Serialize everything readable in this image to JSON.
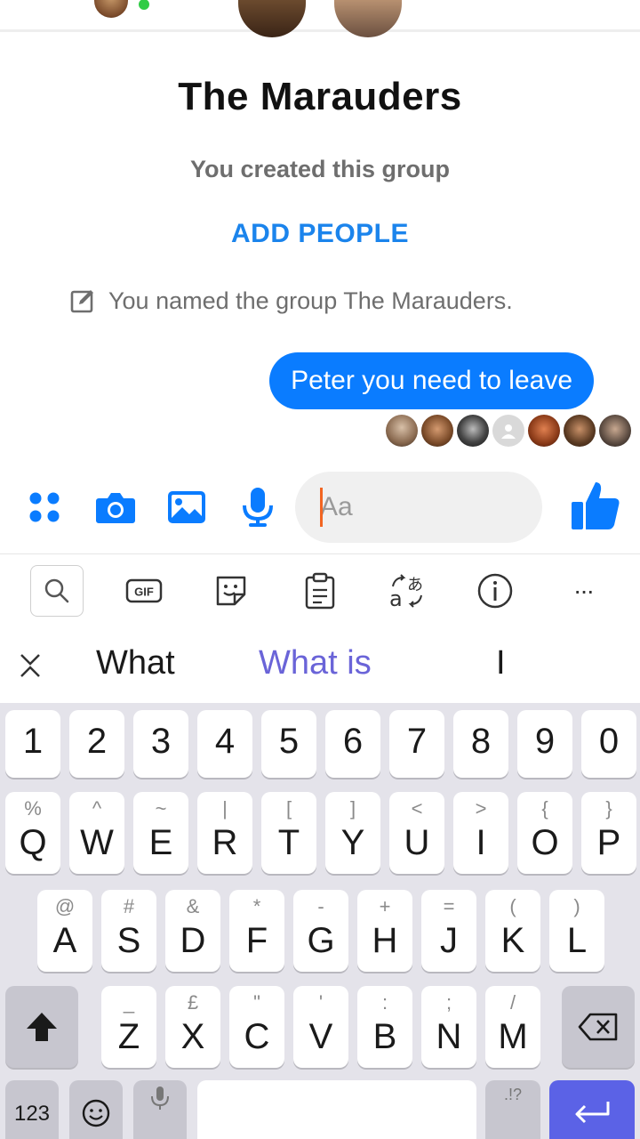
{
  "chat": {
    "title": "The Marauders",
    "created_text": "You created this group",
    "add_people_label": "ADD PEOPLE",
    "named_text": "You named the group The Marauders.",
    "messages": [
      {
        "text": "Peter you need to leave",
        "from": "me"
      }
    ],
    "seen_count": 7
  },
  "composer": {
    "input_placeholder": "Aa",
    "icons": [
      "apps-icon",
      "camera-icon",
      "image-icon",
      "mic-icon",
      "emoji-icon",
      "thumbs-up-icon"
    ]
  },
  "keyboard": {
    "toolbar_icons": [
      "search-icon",
      "gif-icon",
      "sticker-icon",
      "clipboard-icon",
      "translate-icon",
      "info-icon",
      "more-icon"
    ],
    "gif_label": "GIF",
    "more_label": "···",
    "suggestions": [
      "What",
      "What is",
      "I"
    ],
    "number_row": [
      "1",
      "2",
      "3",
      "4",
      "5",
      "6",
      "7",
      "8",
      "9",
      "0"
    ],
    "row1": [
      {
        "main": "Q",
        "alt": "%"
      },
      {
        "main": "W",
        "alt": "^"
      },
      {
        "main": "E",
        "alt": "~"
      },
      {
        "main": "R",
        "alt": "|"
      },
      {
        "main": "T",
        "alt": "["
      },
      {
        "main": "Y",
        "alt": "]"
      },
      {
        "main": "U",
        "alt": "<"
      },
      {
        "main": "I",
        "alt": ">"
      },
      {
        "main": "O",
        "alt": "{"
      },
      {
        "main": "P",
        "alt": "}"
      }
    ],
    "row2": [
      {
        "main": "A",
        "alt": "@"
      },
      {
        "main": "S",
        "alt": "#"
      },
      {
        "main": "D",
        "alt": "&"
      },
      {
        "main": "F",
        "alt": "*"
      },
      {
        "main": "G",
        "alt": "-"
      },
      {
        "main": "H",
        "alt": "+"
      },
      {
        "main": "J",
        "alt": "="
      },
      {
        "main": "K",
        "alt": "("
      },
      {
        "main": "L",
        "alt": ")"
      }
    ],
    "row3": [
      {
        "main": "Z",
        "alt": "_"
      },
      {
        "main": "X",
        "alt": "£"
      },
      {
        "main": "C",
        "alt": "\""
      },
      {
        "main": "V",
        "alt": "'"
      },
      {
        "main": "B",
        "alt": ":"
      },
      {
        "main": "N",
        "alt": ";"
      },
      {
        "main": "M",
        "alt": "/"
      }
    ],
    "sym_label": "123",
    "punct_label": ".!?",
    "accent_color": "#5b62e6",
    "messenger_blue": "#0a7cff"
  }
}
